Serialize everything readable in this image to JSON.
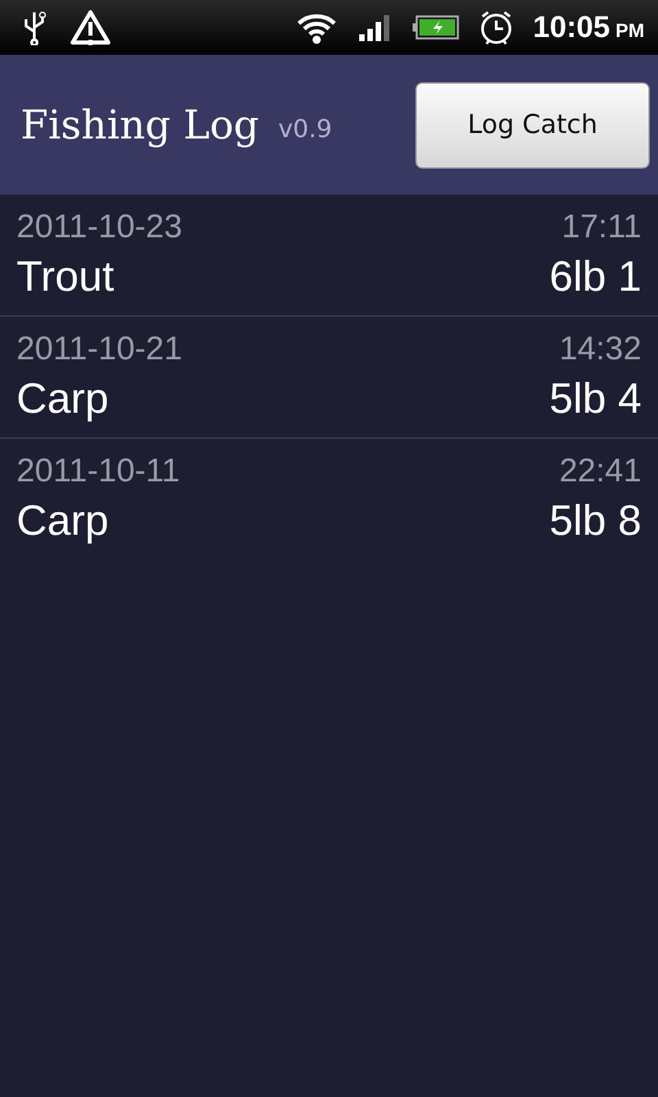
{
  "status_bar": {
    "time": "10:05",
    "meridiem": "PM"
  },
  "header": {
    "title": "Fishing Log",
    "version": "v0.9",
    "button": "Log Catch"
  },
  "catches": [
    {
      "date": "2011-10-23",
      "time": "17:11",
      "species": "Trout",
      "weight": "6lb 1"
    },
    {
      "date": "2011-10-21",
      "time": "14:32",
      "species": "Carp",
      "weight": "5lb 4"
    },
    {
      "date": "2011-10-11",
      "time": "22:41",
      "species": "Carp",
      "weight": "5lb 8"
    }
  ]
}
